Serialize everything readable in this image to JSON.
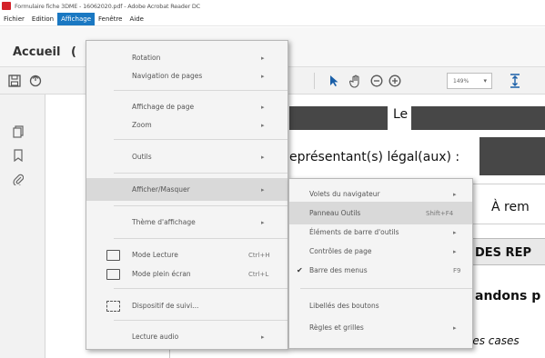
{
  "window": {
    "title": "Formulaire fiche 3DME - 16062020.pdf - Adobe Acrobat Reader DC"
  },
  "menubar": {
    "items": [
      "Fichier",
      "Edition",
      "Affichage",
      "Fenêtre",
      "Aide"
    ]
  },
  "tabs": {
    "home": "Accueil",
    "partial": "("
  },
  "toolbar": {
    "zoom": "149%",
    "zoom_caret": "▾"
  },
  "document": {
    "line_le": "Le",
    "line_representant": "eprésentant(s) légal(aux) :",
    "line_a_rem": "À rem",
    "line_des_rep": "DES REP",
    "line_andons": "andons p",
    "line_cases": "les cases"
  },
  "affichage_menu": {
    "items": [
      {
        "label": "Rotation",
        "has_submenu": true
      },
      {
        "label": "Navigation de pages",
        "has_submenu": true
      },
      {
        "label": "Affichage de page",
        "has_submenu": true
      },
      {
        "label": "Zoom",
        "has_submenu": true
      },
      {
        "label": "Outils",
        "has_submenu": true
      },
      {
        "label": "Afficher/Masquer",
        "has_submenu": true
      },
      {
        "label": "Thème d'affichage",
        "has_submenu": true
      },
      {
        "label": "Mode Lecture",
        "shortcut": "Ctrl+H"
      },
      {
        "label": "Mode plein écran",
        "shortcut": "Ctrl+L"
      },
      {
        "label": "Dispositif de suivi..."
      },
      {
        "label": "Lecture audio",
        "has_submenu": true
      }
    ],
    "arrow": "▸"
  },
  "afficher_masquer_submenu": {
    "items": [
      {
        "label": "Volets du navigateur",
        "has_submenu": true
      },
      {
        "label": "Panneau Outils",
        "shortcut": "Shift+F4"
      },
      {
        "label": "Éléments de barre d'outils",
        "has_submenu": true
      },
      {
        "label": "Contrôles de page",
        "has_submenu": true
      },
      {
        "label": "Barre des menus",
        "shortcut": "F9",
        "checked": true
      },
      {
        "label": "Libellés des boutons"
      },
      {
        "label": "Règles et grilles",
        "has_submenu": true
      }
    ],
    "checkmark": "✔"
  },
  "colors": {
    "menubar_active": "#1a78c2",
    "menu_highlight": "#d9d9d9",
    "doc_dark_bar": "#474747"
  }
}
